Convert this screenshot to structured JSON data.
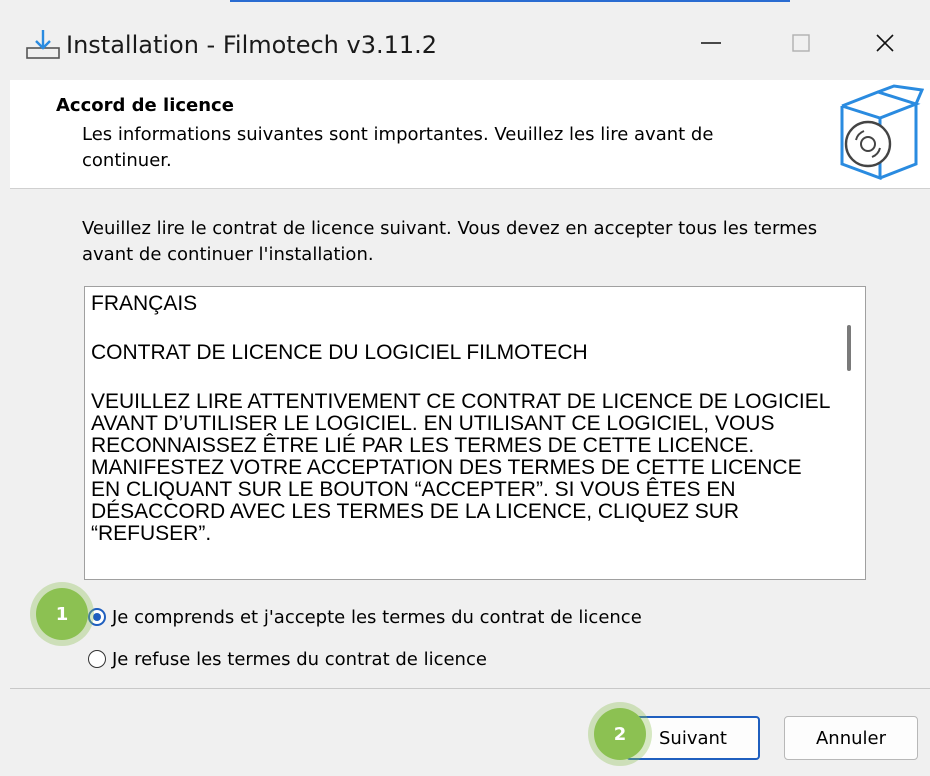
{
  "window": {
    "title": "Installation - Filmotech v3.11.2"
  },
  "header": {
    "title": "Accord de licence",
    "description": "Les informations suivantes sont importantes. Veuillez les lire avant de continuer."
  },
  "intro": "Veuillez lire le contrat de licence suivant. Vous devez en accepter tous les termes avant de continuer l'installation.",
  "license": {
    "paragraphs": [
      "FRANÇAIS",
      "CONTRAT DE LICENCE DU LOGICIEL FILMOTECH",
      "VEUILLEZ LIRE ATTENTIVEMENT CE CONTRAT DE LICENCE DE LOGICIEL AVANT D’UTILISER LE LOGICIEL. EN UTILISANT CE LOGICIEL, VOUS RECONNAISSEZ ÊTRE LIÉ PAR LES TERMES DE CETTE LICENCE. MANIFESTEZ VOTRE ACCEPTATION DES TERMES DE CETTE LICENCE EN CLIQUANT SUR LE BOUTON “ACCEPTER”. SI VOUS ÊTES EN DÉSACCORD AVEC LES TERMES DE LA LICENCE, CLIQUEZ SUR “REFUSER”."
    ]
  },
  "options": {
    "accept_label": "Je comprends et j'accepte les termes du contrat de licence",
    "refuse_label": "Je refuse les termes du contrat de licence",
    "selected": "accept"
  },
  "buttons": {
    "next_label": "Suivant",
    "cancel_label": "Annuler"
  },
  "badges": {
    "one": "1",
    "two": "2"
  },
  "colors": {
    "accent": "#1f5fbf",
    "badge": "#8cc152"
  }
}
